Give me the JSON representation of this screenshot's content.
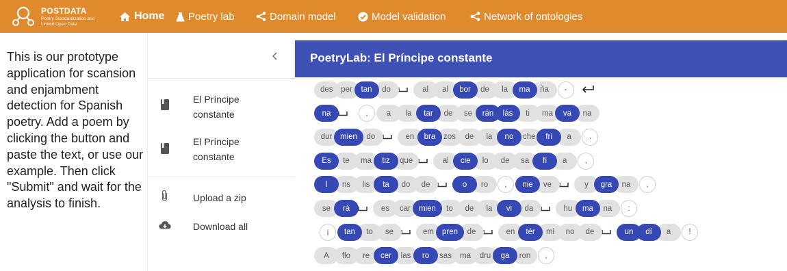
{
  "app": {
    "logo_title": "POSTDATA",
    "logo_subtitle": "Poetry Standardization and Linked Open Data"
  },
  "nav": {
    "items": [
      {
        "label": "Home",
        "icon": "home-icon"
      },
      {
        "label": "Poetry lab",
        "icon": "flask-icon"
      },
      {
        "label": "Domain model",
        "icon": "share-icon"
      },
      {
        "label": "Model validation",
        "icon": "check-circle-icon"
      },
      {
        "label": "Network of ontologies",
        "icon": "share-icon"
      }
    ]
  },
  "intro_text": "This is our prototype application for scansion and enjambment detection for Spanish poetry. Add a poem by clicking the button and paste the text, or use our example. Then click \"Submit\" and wait for the analysis to finish.",
  "sidebar": {
    "collapse_icon": "chevron-left-icon",
    "poems": [
      {
        "line1": "El Príncipe",
        "line2": "constante",
        "icon": "book-icon"
      },
      {
        "line1": "El Príncipe",
        "line2": "constante",
        "icon": "book-icon"
      }
    ],
    "actions": [
      {
        "label": "Upload a zip",
        "icon": "paperclip-icon"
      },
      {
        "label": "Download all",
        "icon": "cloud-download-icon"
      }
    ]
  },
  "panel": {
    "title": "PoetryLab: El Príncipe constante"
  },
  "verses": [
    [
      [
        "des",
        0
      ],
      [
        "per",
        0
      ],
      [
        "tan",
        1
      ],
      [
        "do",
        0
      ],
      [
        "_",
        2
      ],
      [
        "al",
        0
      ],
      [
        "al",
        0
      ],
      [
        "bor",
        1
      ],
      [
        "de",
        0
      ],
      [
        "la",
        0
      ],
      [
        "ma",
        1
      ],
      [
        "ña",
        0
      ],
      [
        "-",
        3
      ],
      [
        "↵",
        4
      ]
    ],
    [
      [
        "na",
        1
      ],
      [
        "_",
        2
      ],
      [
        ",",
        3
      ],
      [
        "a",
        0
      ],
      [
        "la",
        0
      ],
      [
        "tar",
        1
      ],
      [
        "de",
        0
      ],
      [
        "se",
        0
      ],
      [
        "rán",
        1
      ],
      [
        "lás",
        1
      ],
      [
        "ti",
        0
      ],
      [
        "ma",
        0
      ],
      [
        "va",
        1
      ],
      [
        "na",
        0
      ]
    ],
    [
      [
        "dur",
        0
      ],
      [
        "mien",
        1
      ],
      [
        "do",
        0
      ],
      [
        "_",
        2
      ],
      [
        "en",
        0
      ],
      [
        "bra",
        1
      ],
      [
        "zos",
        0
      ],
      [
        "de",
        0
      ],
      [
        "la",
        0
      ],
      [
        "no",
        1
      ],
      [
        "che",
        0
      ],
      [
        "frí",
        1
      ],
      [
        "a",
        0
      ],
      [
        ".",
        3
      ]
    ],
    [
      [
        "Es",
        1
      ],
      [
        "te",
        0
      ],
      [
        "ma",
        0
      ],
      [
        "tiz",
        1
      ],
      [
        "que",
        0
      ],
      [
        "_",
        2
      ],
      [
        "al",
        0
      ],
      [
        "cie",
        1
      ],
      [
        "lo",
        0
      ],
      [
        "de",
        0
      ],
      [
        "sa",
        0
      ],
      [
        "fí",
        1
      ],
      [
        "a",
        0
      ],
      [
        ",",
        3
      ]
    ],
    [
      [
        "l",
        1
      ],
      [
        "ris",
        0
      ],
      [
        "lis",
        0
      ],
      [
        "ta",
        1
      ],
      [
        "do",
        0
      ],
      [
        "de",
        0
      ],
      [
        "_",
        2
      ],
      [
        "o",
        1
      ],
      [
        "ro",
        0
      ],
      [
        ",",
        3
      ],
      [
        "nie",
        1
      ],
      [
        "ve",
        0
      ],
      [
        "_",
        2
      ],
      [
        "y",
        0
      ],
      [
        "gra",
        1
      ],
      [
        "na",
        0
      ],
      [
        ",",
        3
      ]
    ],
    [
      [
        "se",
        0
      ],
      [
        "rá",
        1
      ],
      [
        "_",
        2
      ],
      [
        "es",
        0
      ],
      [
        "car",
        0
      ],
      [
        "mien",
        1
      ],
      [
        "to",
        0
      ],
      [
        "de",
        0
      ],
      [
        "la",
        0
      ],
      [
        "vi",
        1
      ],
      [
        "da",
        0
      ],
      [
        "_",
        2
      ],
      [
        "hu",
        0
      ],
      [
        "ma",
        1
      ],
      [
        "na",
        0
      ],
      [
        ":",
        3
      ]
    ],
    [
      [
        "¡",
        3
      ],
      [
        "tan",
        1
      ],
      [
        "to",
        0
      ],
      [
        "se",
        0
      ],
      [
        "_",
        2
      ],
      [
        "em",
        0
      ],
      [
        "pren",
        1
      ],
      [
        "de",
        0
      ],
      [
        "_",
        2
      ],
      [
        "en",
        0
      ],
      [
        "tér",
        1
      ],
      [
        "mi",
        0
      ],
      [
        "no",
        0
      ],
      [
        "de",
        0
      ],
      [
        "_",
        2
      ],
      [
        "un",
        1
      ],
      [
        "dí",
        1
      ],
      [
        "a",
        0
      ],
      [
        "!",
        3
      ]
    ],
    [
      [
        "A",
        0
      ],
      [
        "flo",
        0
      ],
      [
        "re",
        0
      ],
      [
        "cer",
        1
      ],
      [
        "las",
        0
      ],
      [
        "ro",
        1
      ],
      [
        "sas",
        0
      ],
      [
        "ma",
        0
      ],
      [
        "dru",
        0
      ],
      [
        "ga",
        1
      ],
      [
        "ron",
        0
      ],
      [
        ",",
        3
      ]
    ]
  ]
}
